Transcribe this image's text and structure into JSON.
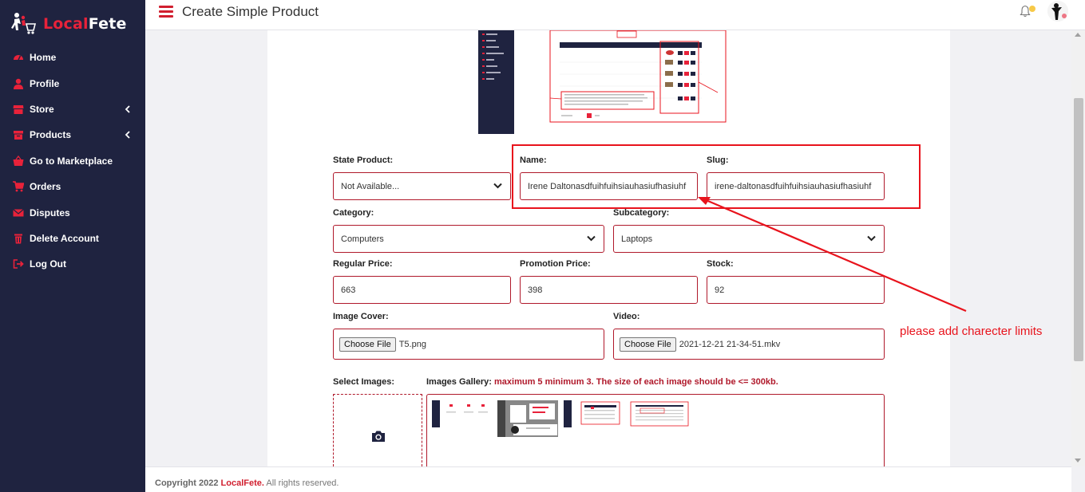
{
  "brand": {
    "local": "Local",
    "fete": "Fete"
  },
  "sidebar": {
    "items": [
      {
        "label": "Home",
        "icon": "dashboard-icon"
      },
      {
        "label": "Profile",
        "icon": "user-icon"
      },
      {
        "label": "Store",
        "icon": "store-icon",
        "expandable": true
      },
      {
        "label": "Products",
        "icon": "box-icon",
        "expandable": true
      },
      {
        "label": "Go to Marketplace",
        "icon": "basket-icon"
      },
      {
        "label": "Orders",
        "icon": "cart-icon"
      },
      {
        "label": "Disputes",
        "icon": "envelope-icon"
      },
      {
        "label": "Delete Account",
        "icon": "trash-icon"
      },
      {
        "label": "Log Out",
        "icon": "logout-icon"
      }
    ]
  },
  "topbar": {
    "title": "Create Simple Product",
    "notification_badge": ""
  },
  "form": {
    "state_product": {
      "label": "State Product:",
      "value": "Not Available..."
    },
    "name": {
      "label": "Name:",
      "value": "Irene Daltonasdfuihfuihsiauhasiufhasiuhf"
    },
    "slug": {
      "label": "Slug:",
      "value": "irene-daltonasdfuihfuihsiauhasiufhasiuhf"
    },
    "category": {
      "label": "Category:",
      "value": "Computers"
    },
    "subcategory": {
      "label": "Subcategory:",
      "value": "Laptops"
    },
    "regular_price": {
      "label": "Regular Price:",
      "value": "663"
    },
    "promotion_price": {
      "label": "Promotion Price:",
      "value": "398"
    },
    "stock": {
      "label": "Stock:",
      "value": "92"
    },
    "image_cover": {
      "label": "Image Cover:",
      "button": "Choose File",
      "file": "T5.png"
    },
    "video": {
      "label": "Video:",
      "button": "Choose File",
      "file": "2021-12-21 21-34-51.mkv"
    },
    "select_images": {
      "label": "Select Images:"
    },
    "gallery": {
      "label": "Images Gallery:",
      "note": "maximum 5 minimum 3. The size of each image should be <= 300kb."
    }
  },
  "footer": {
    "copyright": "Copyright 2022",
    "brand": "LocalFete.",
    "rights": "All rights reserved."
  },
  "annotation": {
    "text": "please add charecter limits",
    "color": "#e8131c"
  },
  "colors": {
    "sidebar_bg": "#1f2340",
    "accent": "#d11f2f",
    "field_border": "#b0192b"
  }
}
